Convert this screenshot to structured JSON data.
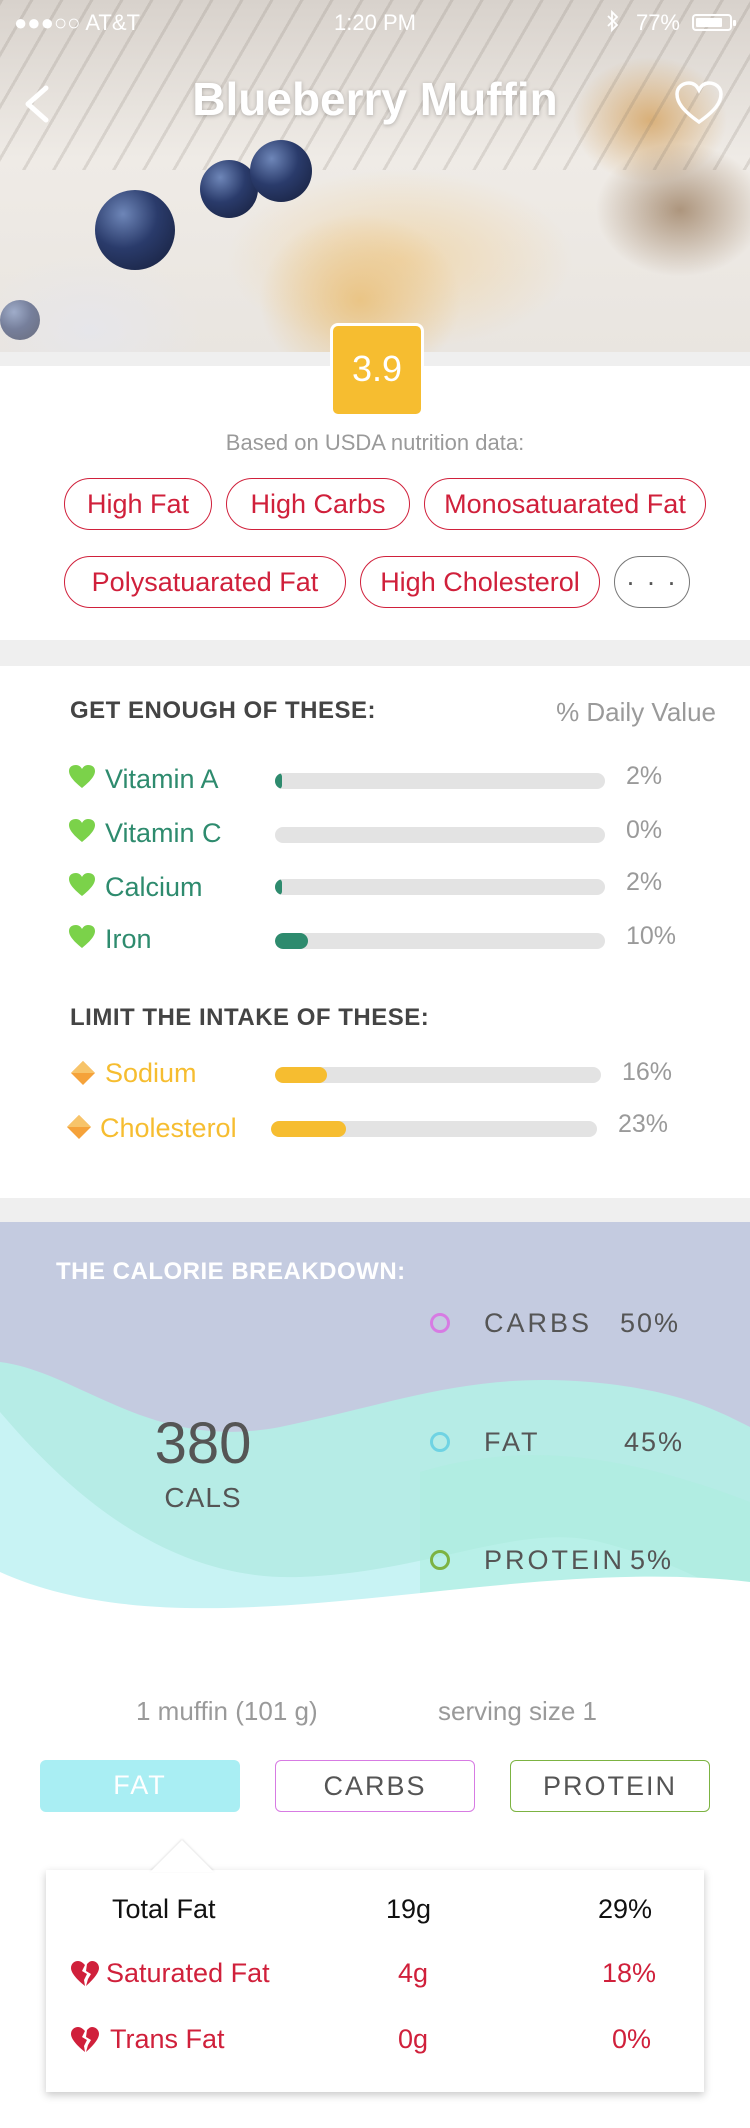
{
  "status_bar": {
    "carrier": "●●●○○ AT&T",
    "time": "1:20 PM",
    "battery": "77%"
  },
  "header": {
    "title": "Blueberry Muffin"
  },
  "score": "3.9",
  "based_on": "Based on USDA nutrition data:",
  "tags": [
    "High Fat",
    "High Carbs",
    "Monosatuarated Fat",
    "Polysatuarated Fat",
    "High Cholesterol",
    "· · ·"
  ],
  "get_enough": {
    "heading": "GET ENOUGH OF THESE:",
    "dv_label": "% Daily Value",
    "items": [
      {
        "label": "Vitamin A",
        "pct": "2%",
        "value": 2
      },
      {
        "label": "Vitamin C",
        "pct": "0%",
        "value": 0
      },
      {
        "label": "Calcium",
        "pct": "2%",
        "value": 2
      },
      {
        "label": "Iron",
        "pct": "10%",
        "value": 10
      }
    ]
  },
  "limit": {
    "heading": "LIMIT THE INTAKE OF THESE:",
    "items": [
      {
        "label": "Sodium",
        "pct": "16%",
        "value": 16
      },
      {
        "label": "Cholesterol",
        "pct": "23%",
        "value": 23
      }
    ]
  },
  "calories": {
    "heading": "THE CALORIE BREAKDOWN:",
    "value": "380",
    "unit": "CALS",
    "legend": [
      {
        "label": "CARBS",
        "pct": "50%",
        "color": "#d77be3"
      },
      {
        "label": "FAT",
        "pct": "45%",
        "color": "#6fd3e3"
      },
      {
        "label": "PROTEIN",
        "pct": "5%",
        "color": "#7cb342"
      }
    ]
  },
  "serving": {
    "amount": "1 muffin (101 g)",
    "size": "serving size 1"
  },
  "tabs": [
    "FAT",
    "CARBS",
    "PROTEIN"
  ],
  "fat_table": [
    {
      "name": "Total Fat",
      "amount": "19g",
      "pct": "29%"
    },
    {
      "name": "Saturated Fat",
      "amount": "4g",
      "pct": "18%"
    },
    {
      "name": "Trans Fat",
      "amount": "0g",
      "pct": "0%"
    }
  ],
  "colors": {
    "accent_yellow": "#f6bd30",
    "tag_red": "#d0203b",
    "good_green": "#2e8b6e",
    "limit_orange": "#f6bd30"
  }
}
